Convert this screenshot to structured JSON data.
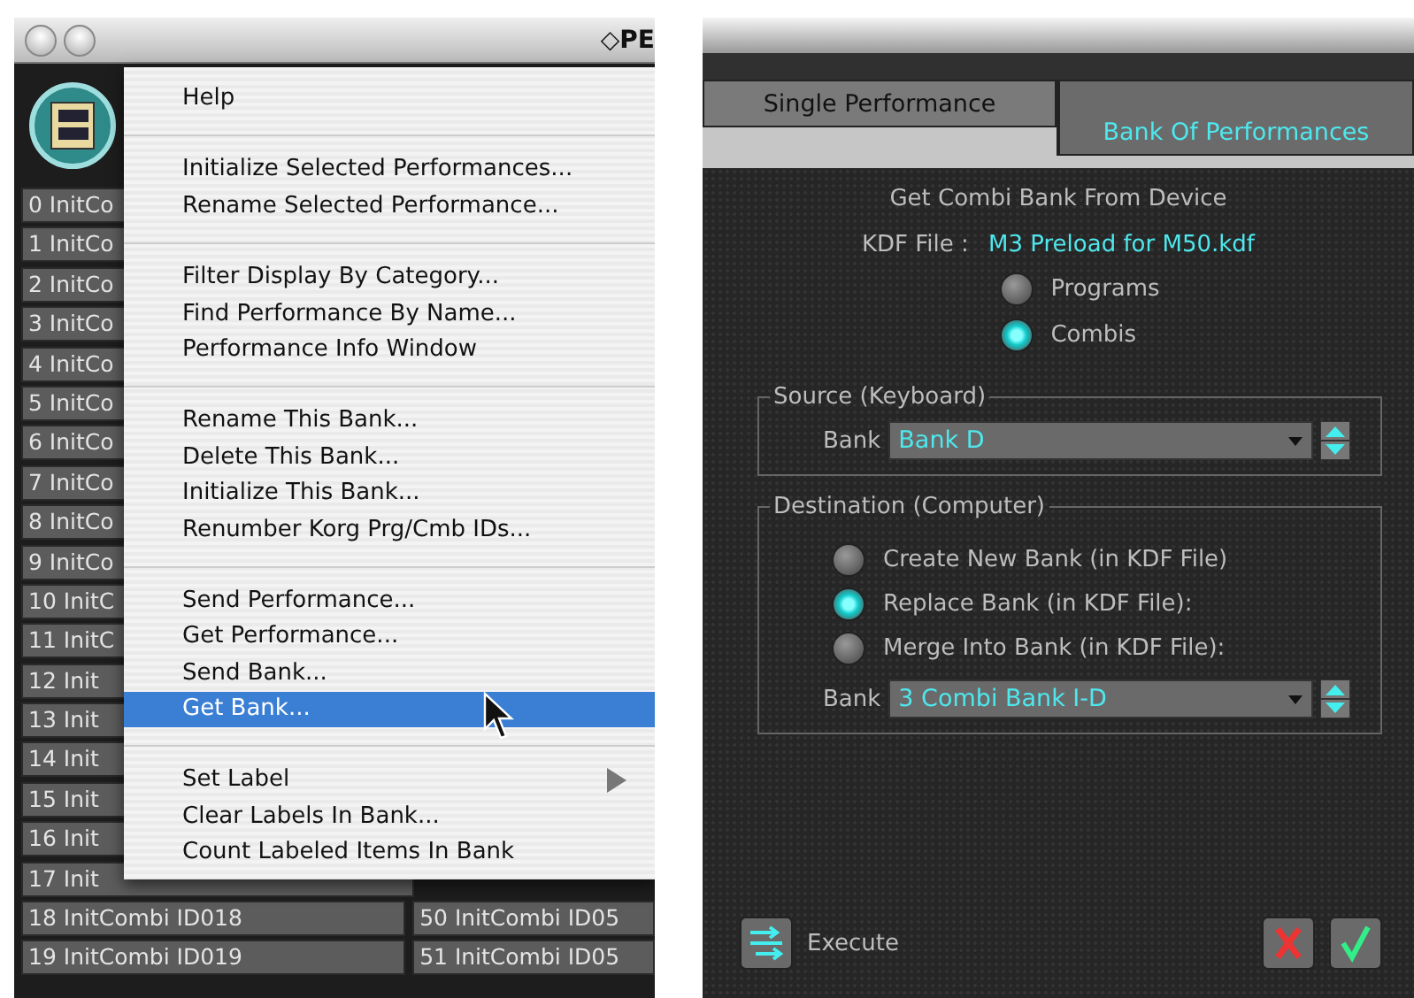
{
  "left_window": {
    "title": "◇PE",
    "rows": [
      {
        "cells": [
          "0 InitCo"
        ]
      },
      {
        "cells": [
          "1 InitCo"
        ]
      },
      {
        "cells": [
          "2 InitCo"
        ]
      },
      {
        "cells": [
          "3 InitCo"
        ]
      },
      {
        "cells": [
          "4 InitCo"
        ]
      },
      {
        "cells": [
          "5 InitCo"
        ]
      },
      {
        "cells": [
          "6 InitCo"
        ]
      },
      {
        "cells": [
          "7 InitCo"
        ]
      },
      {
        "cells": [
          "8 InitCo"
        ]
      },
      {
        "cells": [
          "9 InitCo"
        ]
      },
      {
        "cells": [
          "10 InitC"
        ]
      },
      {
        "cells": [
          "11 InitC"
        ]
      },
      {
        "cells": [
          "12 Init"
        ]
      },
      {
        "cells": [
          "13 Init"
        ]
      },
      {
        "cells": [
          "14 Init"
        ]
      },
      {
        "cells": [
          "15 Init"
        ]
      },
      {
        "cells": [
          "16 Init"
        ]
      },
      {
        "cells": [
          "17 Init"
        ]
      },
      {
        "cells": [
          "18 InitCombi ID018",
          "50 InitCombi ID05"
        ]
      },
      {
        "cells": [
          "19 InitCombi ID019",
          "51 InitCombi ID05"
        ]
      }
    ],
    "menu": {
      "groups": [
        [
          {
            "label": "Help",
            "selected": false,
            "submenu": false
          }
        ],
        [
          {
            "label": "Initialize Selected Performances...",
            "selected": false,
            "submenu": false
          },
          {
            "label": "Rename Selected Performance...",
            "selected": false,
            "submenu": false
          }
        ],
        [
          {
            "label": "Filter Display By Category...",
            "selected": false,
            "submenu": false
          },
          {
            "label": "Find Performance By Name...",
            "selected": false,
            "submenu": false
          },
          {
            "label": "Performance Info Window",
            "selected": false,
            "submenu": false
          }
        ],
        [
          {
            "label": "Rename This Bank...",
            "selected": false,
            "submenu": false
          },
          {
            "label": "Delete This Bank...",
            "selected": false,
            "submenu": false
          },
          {
            "label": "Initialize This Bank...",
            "selected": false,
            "submenu": false
          },
          {
            "label": "Renumber Korg Prg/Cmb IDs...",
            "selected": false,
            "submenu": false
          }
        ],
        [
          {
            "label": "Send Performance...",
            "selected": false,
            "submenu": false
          },
          {
            "label": "Get Performance...",
            "selected": false,
            "submenu": false
          },
          {
            "label": "Send Bank...",
            "selected": false,
            "submenu": false
          },
          {
            "label": "Get Bank...",
            "selected": true,
            "submenu": false
          }
        ],
        [
          {
            "label": "Set Label",
            "selected": false,
            "submenu": true
          },
          {
            "label": "Clear Labels In Bank...",
            "selected": false,
            "submenu": false
          },
          {
            "label": "Count Labeled Items In Bank",
            "selected": false,
            "submenu": false
          }
        ]
      ]
    }
  },
  "right_window": {
    "tabs": [
      {
        "label": "Single Performance",
        "selected": false
      },
      {
        "label": "Bank Of Performances",
        "selected": true
      }
    ],
    "heading": "Get Combi Bank From Device",
    "kdf_label": "KDF File :",
    "kdf_file": "M3 Preload for M50.kdf",
    "type_options": [
      {
        "label": "Programs",
        "selected": false
      },
      {
        "label": "Combis",
        "selected": true
      }
    ],
    "source": {
      "title": "Source (Keyboard)",
      "bank_label": "Bank",
      "bank_value": "Bank D"
    },
    "destination": {
      "title": "Destination (Computer)",
      "options": [
        {
          "label": "Create New Bank (in KDF File)",
          "selected": false
        },
        {
          "label": "Replace Bank (in KDF File):",
          "selected": true
        },
        {
          "label": "Merge Into Bank (in KDF File):",
          "selected": false
        }
      ],
      "bank_label": "Bank",
      "bank_value": "3 Combi Bank I-D"
    },
    "execute_label": "Execute"
  }
}
